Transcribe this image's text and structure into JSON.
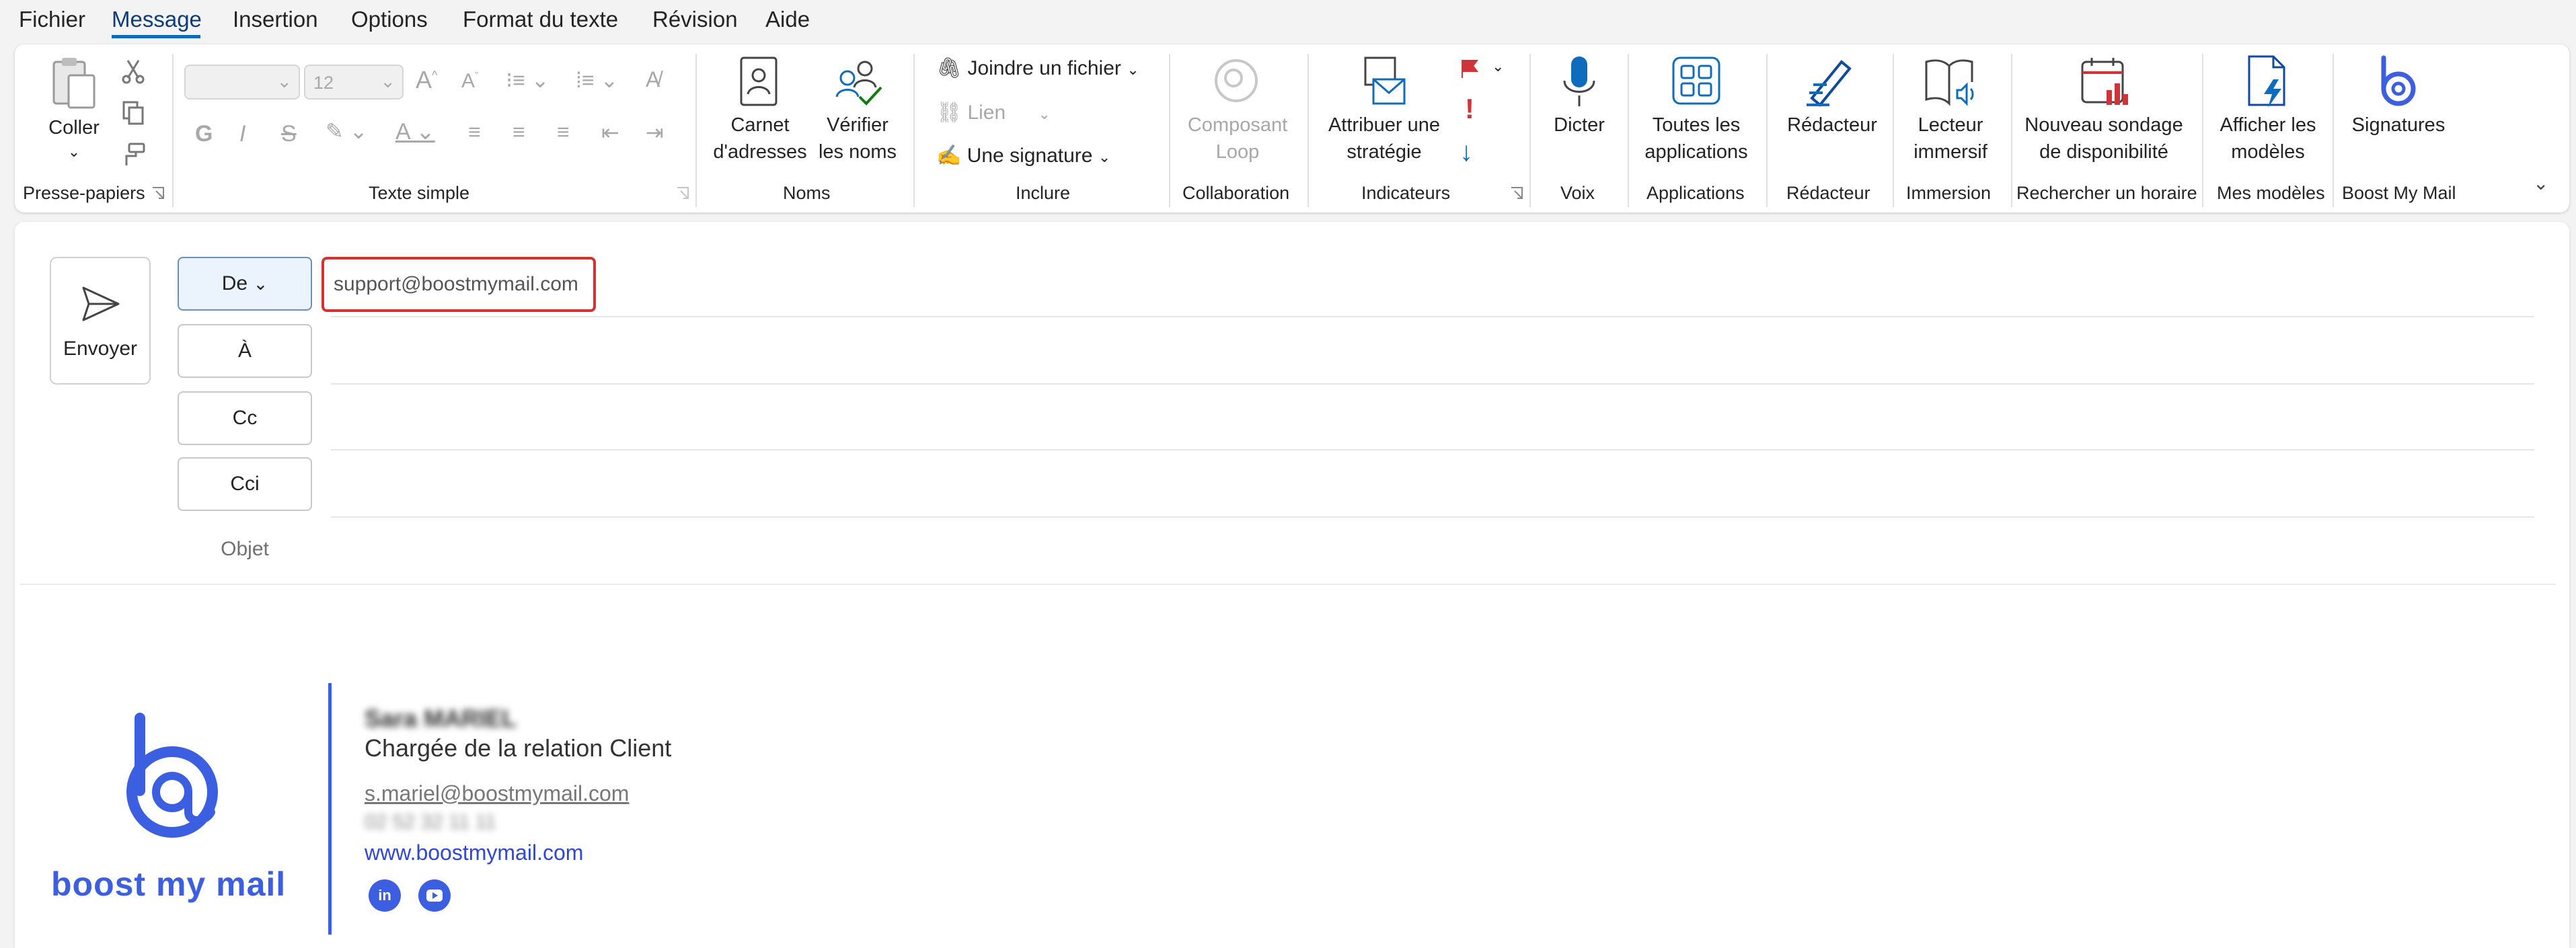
{
  "menu": {
    "items": [
      "Fichier",
      "Message",
      "Insertion",
      "Options",
      "Format du texte",
      "Révision",
      "Aide"
    ],
    "active": "Message"
  },
  "ribbon": {
    "clipboard": {
      "paste_label": "Coller",
      "group": "Presse-papiers"
    },
    "basic_text": {
      "font_name": "",
      "font_size": "12",
      "group": "Texte simple"
    },
    "names": {
      "address_book": "Carnet\nd'adresses",
      "check_names": "Vérifier\nles noms",
      "group": "Noms"
    },
    "include": {
      "attach_file": "Joindre un fichier",
      "link": "Lien",
      "signature": "Une signature",
      "group": "Inclure"
    },
    "collaboration": {
      "loop": "Composant\nLoop",
      "group": "Collaboration"
    },
    "tags": {
      "assign_policy": "Attribuer une\nstratégie",
      "group": "Indicateurs"
    },
    "voice": {
      "dictate": "Dicter",
      "group": "Voix"
    },
    "apps": {
      "all_apps": "Toutes les\napplications",
      "group": "Applications"
    },
    "editor": {
      "editor": "Rédacteur",
      "group": "Rédacteur"
    },
    "immersive": {
      "reader": "Lecteur\nimmersif",
      "group": "Immersion"
    },
    "scheduling": {
      "poll": "Nouveau sondage\nde disponibilité",
      "group": "Rechercher un horaire"
    },
    "templates": {
      "view": "Afficher les\nmodèles",
      "group": "Mes modèles"
    },
    "boostmymail": {
      "signatures": "Signatures",
      "group": "Boost My Mail"
    }
  },
  "compose": {
    "send_label": "Envoyer",
    "from_label": "De",
    "to_label": "À",
    "cc_label": "Cc",
    "bcc_label": "Cci",
    "subject_placeholder": "Objet",
    "from_value": "support@boostmymail.com"
  },
  "signature": {
    "logo_text": "boost my mail",
    "name": "Sara MARIEL",
    "title": "Chargée de la relation Client",
    "email": "s.mariel@boostmymail.com",
    "phone": "02 52 32 11 11",
    "website": "www.boostmymail.com",
    "accent_color": "#2f46d6"
  }
}
